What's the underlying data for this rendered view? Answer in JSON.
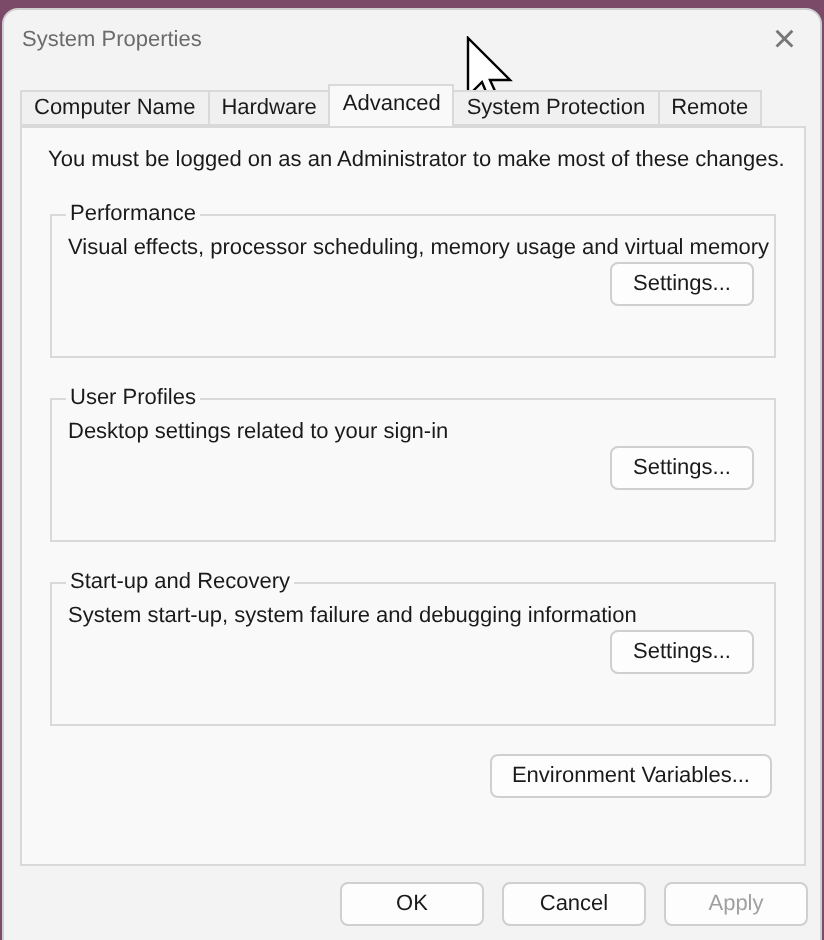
{
  "window": {
    "title": "System Properties",
    "close": "×"
  },
  "tabs": [
    {
      "label": "Computer Name",
      "selected": false
    },
    {
      "label": "Hardware",
      "selected": false
    },
    {
      "label": "Advanced",
      "selected": true
    },
    {
      "label": "System Protection",
      "selected": false
    },
    {
      "label": "Remote",
      "selected": false
    }
  ],
  "notice": "You must be logged on as an Administrator to make most of these changes.",
  "groups": [
    {
      "title": "Performance",
      "description": "Visual effects, processor scheduling, memory usage and virtual memory",
      "button": "Settings..."
    },
    {
      "title": "User Profiles",
      "description": "Desktop settings related to your sign-in",
      "button": "Settings..."
    },
    {
      "title": "Start-up and Recovery",
      "description": "System start-up, system failure and debugging information",
      "button": "Settings..."
    }
  ],
  "environment_button": "Environment Variables...",
  "buttons": [
    {
      "label": "OK",
      "disabled": false
    },
    {
      "label": "Cancel",
      "disabled": false
    },
    {
      "label": "Apply",
      "disabled": true
    }
  ]
}
